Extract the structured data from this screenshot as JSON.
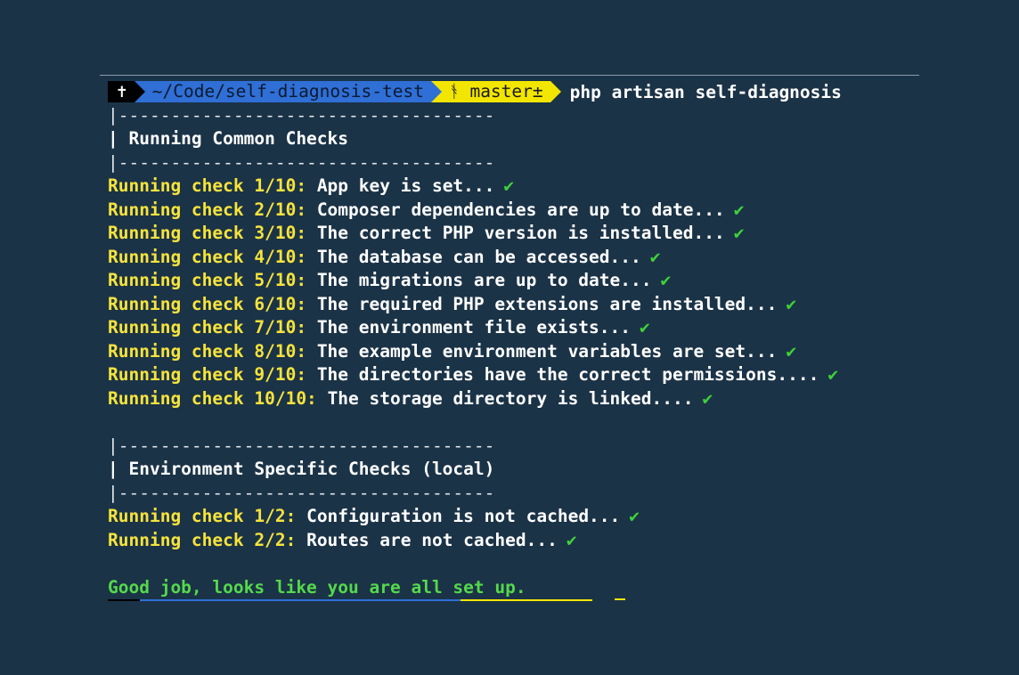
{
  "prompt": {
    "root_symbol": "✝",
    "path": "~/Code/self-diagnosis-test",
    "branch_symbol": "ᚬ",
    "branch": "master±",
    "command": "php artisan self-diagnosis"
  },
  "colors": {
    "background": "#1b3347",
    "segment_root": "#000000",
    "segment_path": "#2f6fd6",
    "segment_git": "#f2e600",
    "label_yellow": "#f6e33c",
    "success_green": "#55d94b"
  },
  "separator": "|------------------------------------",
  "common": {
    "heading": "| Running Common Checks",
    "checks": [
      {
        "label": "Running check 1/10:",
        "text": "App key is set...",
        "mark": "✔"
      },
      {
        "label": "Running check 2/10:",
        "text": "Composer dependencies are up to date...",
        "mark": "✔"
      },
      {
        "label": "Running check 3/10:",
        "text": "The correct PHP version is installed...",
        "mark": "✔"
      },
      {
        "label": "Running check 4/10:",
        "text": "The database can be accessed...",
        "mark": "✔"
      },
      {
        "label": "Running check 5/10:",
        "text": "The migrations are up to date...",
        "mark": "✔"
      },
      {
        "label": "Running check 6/10:",
        "text": "The required PHP extensions are installed...",
        "mark": "✔"
      },
      {
        "label": "Running check 7/10:",
        "text": "The environment file exists...",
        "mark": "✔"
      },
      {
        "label": "Running check 8/10:",
        "text": "The example environment variables are set...",
        "mark": "✔"
      },
      {
        "label": "Running check 9/10:",
        "text": "The directories have the correct permissions....",
        "mark": "✔"
      },
      {
        "label": "Running check 10/10:",
        "text": "The storage directory is linked....",
        "mark": "✔"
      }
    ]
  },
  "environment": {
    "heading": "| Environment Specific Checks (local)",
    "checks": [
      {
        "label": "Running check 1/2:",
        "text": "Configuration is not cached...",
        "mark": "✔"
      },
      {
        "label": "Running check 2/2:",
        "text": "Routes are not cached...",
        "mark": "✔"
      }
    ]
  },
  "result": "Good job, looks like you are all set up."
}
